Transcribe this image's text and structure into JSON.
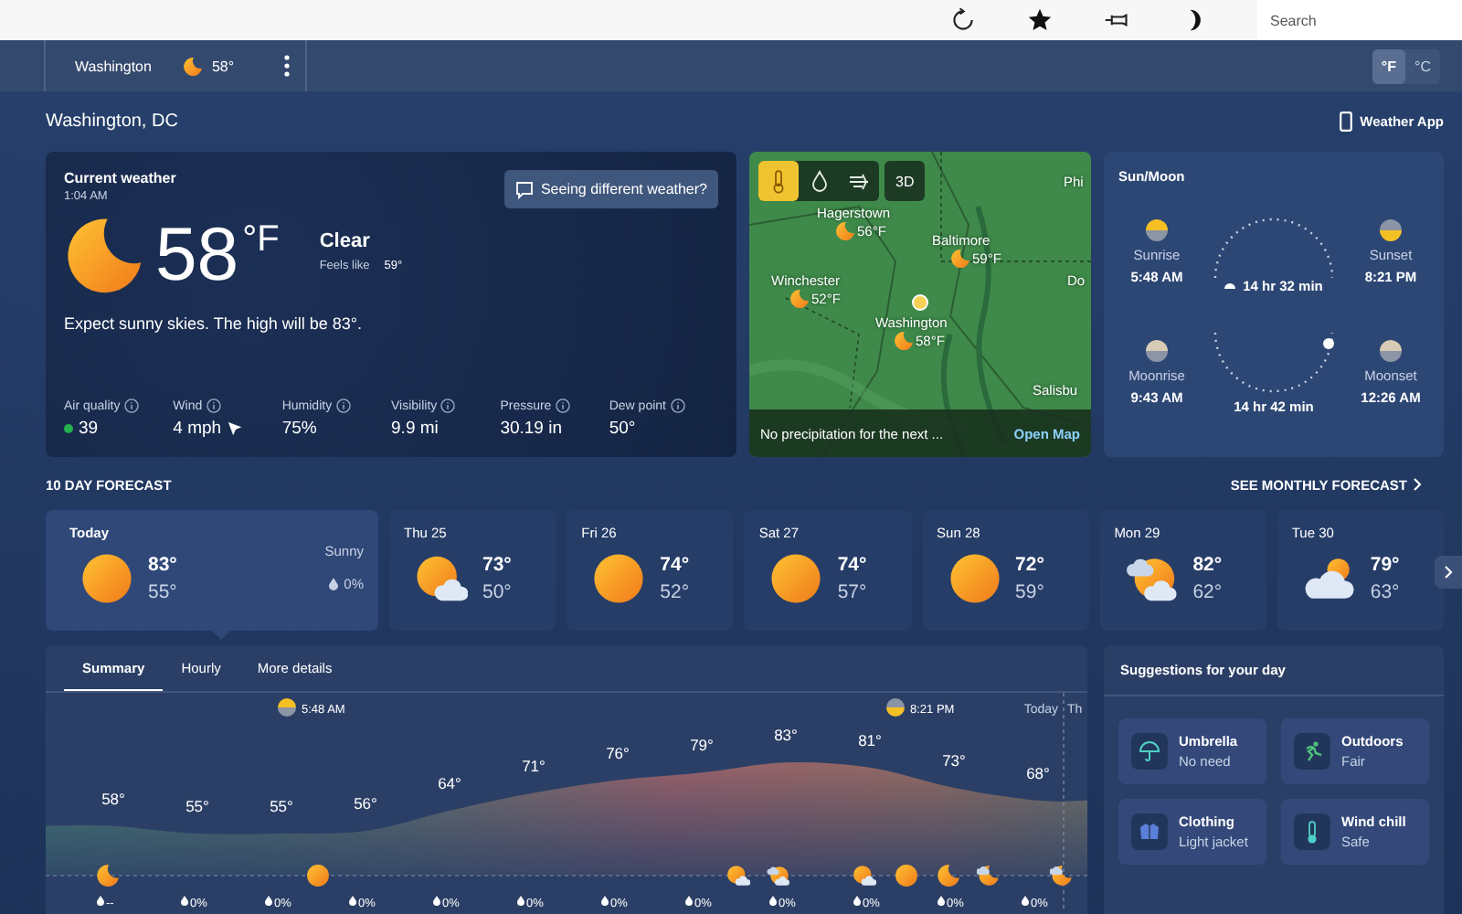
{
  "browser_toolbar": {
    "search": {
      "placeholder": "Search"
    }
  },
  "location_bar": {
    "location": "Washington",
    "temperature": "58°",
    "units": [
      {
        "label": "°F",
        "selected": true
      },
      {
        "label": "°C",
        "selected": false
      }
    ]
  },
  "header": {
    "title": "Washington, DC",
    "app_link": "Weather App"
  },
  "current_weather": {
    "title": "Current weather",
    "time": "1:04 AM",
    "temperature": "58",
    "unit": "°F",
    "condition": "Clear",
    "feels_like_label": "Feels like",
    "feels_like": "59°",
    "feedback_button": "Seeing different weather?",
    "summary": "Expect sunny skies. The high will be 83°.",
    "details": [
      {
        "label": "Air quality",
        "value": "39",
        "color": "#22b14c"
      },
      {
        "label": "Wind",
        "value": "4 mph",
        "kind": "wind"
      },
      {
        "label": "Humidity",
        "value": "75%"
      },
      {
        "label": "Visibility",
        "value": "9.9 mi"
      },
      {
        "label": "Pressure",
        "value": "30.19 in"
      },
      {
        "label": "Dew point",
        "value": "50°"
      }
    ]
  },
  "map": {
    "layers": [
      {
        "kind": "temperature",
        "selected": true
      },
      {
        "kind": "precipitation",
        "selected": false
      },
      {
        "kind": "wind",
        "selected": false
      }
    ],
    "view_button": "3D",
    "cities": [
      {
        "name": "Hagerstown",
        "temperature": "56°F"
      },
      {
        "name": "Baltimore",
        "temperature": "59°F"
      },
      {
        "name": "Winchester",
        "temperature": "52°F"
      },
      {
        "name": "Washington",
        "temperature": "58°F",
        "current": true
      },
      {
        "name": "Phi"
      },
      {
        "name": "Do"
      },
      {
        "name": "Salisbu"
      }
    ],
    "footer": "No precipitation for the next ...",
    "link": "Open Map"
  },
  "sun_moon": {
    "title": "Sun/Moon",
    "sunrise": {
      "label": "Sunrise",
      "time": "5:48 AM"
    },
    "sunset": {
      "label": "Sunset",
      "time": "8:21 PM"
    },
    "day_length": "14 hr 32 min",
    "moonrise": {
      "label": "Moonrise",
      "time": "9:43 AM"
    },
    "moonset": {
      "label": "Moonset",
      "time": "12:26 AM"
    },
    "moon_length": "14 hr 42 min"
  },
  "forecast": {
    "title": "10 DAY FORECAST",
    "monthly_link": "SEE MONTHLY FORECAST",
    "days": [
      {
        "day": "Today",
        "kind": "sun",
        "high": "83°",
        "low": "55°",
        "condition": "Sunny",
        "precipitation": "0%",
        "selected": true
      },
      {
        "day": "Thu 25",
        "kind": "sun-cloud",
        "high": "73°",
        "low": "50°",
        "selected": false
      },
      {
        "day": "Fri 26",
        "kind": "sun",
        "high": "74°",
        "low": "52°",
        "selected": false
      },
      {
        "day": "Sat 27",
        "kind": "sun",
        "high": "74°",
        "low": "57°",
        "selected": false
      },
      {
        "day": "Sun 28",
        "kind": "sun",
        "high": "72°",
        "low": "59°",
        "selected": false
      },
      {
        "day": "Mon 29",
        "kind": "cloudy-sun",
        "high": "82°",
        "low": "62°",
        "selected": false
      },
      {
        "day": "Tue 30",
        "kind": "cloud",
        "high": "79°",
        "low": "63°",
        "selected": false
      }
    ]
  },
  "day_chart": {
    "tabs": [
      {
        "label": "Summary",
        "selected": true
      },
      {
        "label": "Hourly",
        "selected": false
      },
      {
        "label": "More details",
        "selected": false
      }
    ],
    "sunrise_time": "5:48 AM",
    "sunset_time": "8:21 PM",
    "day_labels": [
      "Today",
      "Th"
    ],
    "temperatures": [
      "58°",
      "55°",
      "55°",
      "56°",
      "64°",
      "71°",
      "76°",
      "79°",
      "83°",
      "81°",
      "73°",
      "68°"
    ],
    "condition_icons": [
      {
        "kind": "moon"
      },
      {
        "kind": "sun"
      },
      {
        "kind": "sun-cloud"
      },
      {
        "kind": "cloudy-sun"
      },
      {
        "kind": "sun-cloud"
      },
      {
        "kind": "sun"
      },
      {
        "kind": "moon"
      },
      {
        "kind": "moon-cloud"
      },
      {
        "kind": "moon-cloud"
      }
    ],
    "precipitation": [
      "--",
      "0%",
      "0%",
      "0%",
      "0%",
      "0%",
      "0%",
      "0%",
      "0%",
      "0%",
      "0%",
      "0%"
    ]
  },
  "suggestions": {
    "title": "Suggestions for your day",
    "items": [
      {
        "kind": "umbrella",
        "title": "Umbrella",
        "value": "No need"
      },
      {
        "kind": "outdoors",
        "title": "Outdoors",
        "value": "Fair"
      },
      {
        "kind": "clothing",
        "title": "Clothing",
        "value": "Light jacket"
      },
      {
        "kind": "wind-chill",
        "title": "Wind chill",
        "value": "Safe"
      }
    ]
  }
}
